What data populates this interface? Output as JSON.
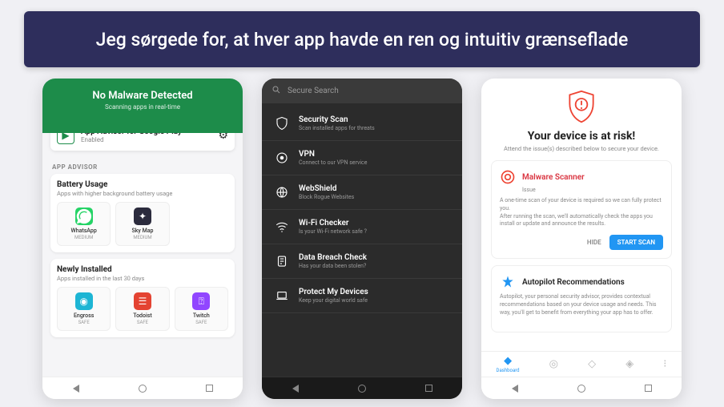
{
  "banner": {
    "text": "Jeg sørgede for, at hver app havde en ren og intuitiv grænseflade"
  },
  "phone1": {
    "header_title": "No Malware Detected",
    "header_sub": "Scanning apps in real-time",
    "advisor_title": "App Advisor for Google Play",
    "advisor_sub": "Enabled",
    "section_label": "APP ADVISOR",
    "battery": {
      "title": "Battery Usage",
      "sub": "Apps with higher background battery usage",
      "apps": [
        {
          "name": "WhatsApp",
          "status": "MEDIUM",
          "color": "#25d366"
        },
        {
          "name": "Sky Map",
          "status": "MEDIUM",
          "color": "#2b2b3d"
        }
      ]
    },
    "newly": {
      "title": "Newly Installed",
      "sub": "Apps installed in the last 30 days",
      "apps": [
        {
          "name": "Engross",
          "status": "SAFE",
          "color": "#1db5d4"
        },
        {
          "name": "Todoist",
          "status": "SAFE",
          "color": "#e44332"
        },
        {
          "name": "Twitch",
          "status": "SAFE",
          "color": "#9146ff"
        }
      ]
    }
  },
  "phone2": {
    "search_placeholder": "Secure Search",
    "items": [
      {
        "title": "Security Scan",
        "sub": "Scan installed apps for threats",
        "icon": "shield"
      },
      {
        "title": "VPN",
        "sub": "Connect to our VPN service",
        "icon": "vpn"
      },
      {
        "title": "WebShield",
        "sub": "Block Rogue Websites",
        "icon": "globe"
      },
      {
        "title": "Wi-Fi Checker",
        "sub": "Is your Wi-Fi network safe ?",
        "icon": "wifi"
      },
      {
        "title": "Data Breach Check",
        "sub": "Has your data been stolen?",
        "icon": "data"
      },
      {
        "title": "Protect My Devices",
        "sub": "Keep your digital world safe",
        "icon": "laptop"
      }
    ]
  },
  "phone3": {
    "title": "Your device is at risk!",
    "sub": "Attend the issue(s) described below to secure your device.",
    "malware": {
      "title": "Malware Scanner",
      "issue_label": "Issue",
      "body1": "A one-time scan of your device is required so we can fully protect you.",
      "body2": "After running the scan, we'll automatically check the apps you install or update and announce the results.",
      "hide": "HIDE",
      "scan": "START SCAN"
    },
    "autopilot": {
      "title": "Autopilot Recommendations",
      "body": "Autopilot, your personal security advisor, provides contextual recommendations based on your device usage and needs. This way, you'll get to benefit from everything your app has to offer."
    },
    "tabs": [
      {
        "label": "Dashboard",
        "active": true
      },
      {
        "label": "",
        "active": false
      },
      {
        "label": "",
        "active": false
      },
      {
        "label": "",
        "active": false
      },
      {
        "label": "",
        "active": false
      }
    ]
  }
}
